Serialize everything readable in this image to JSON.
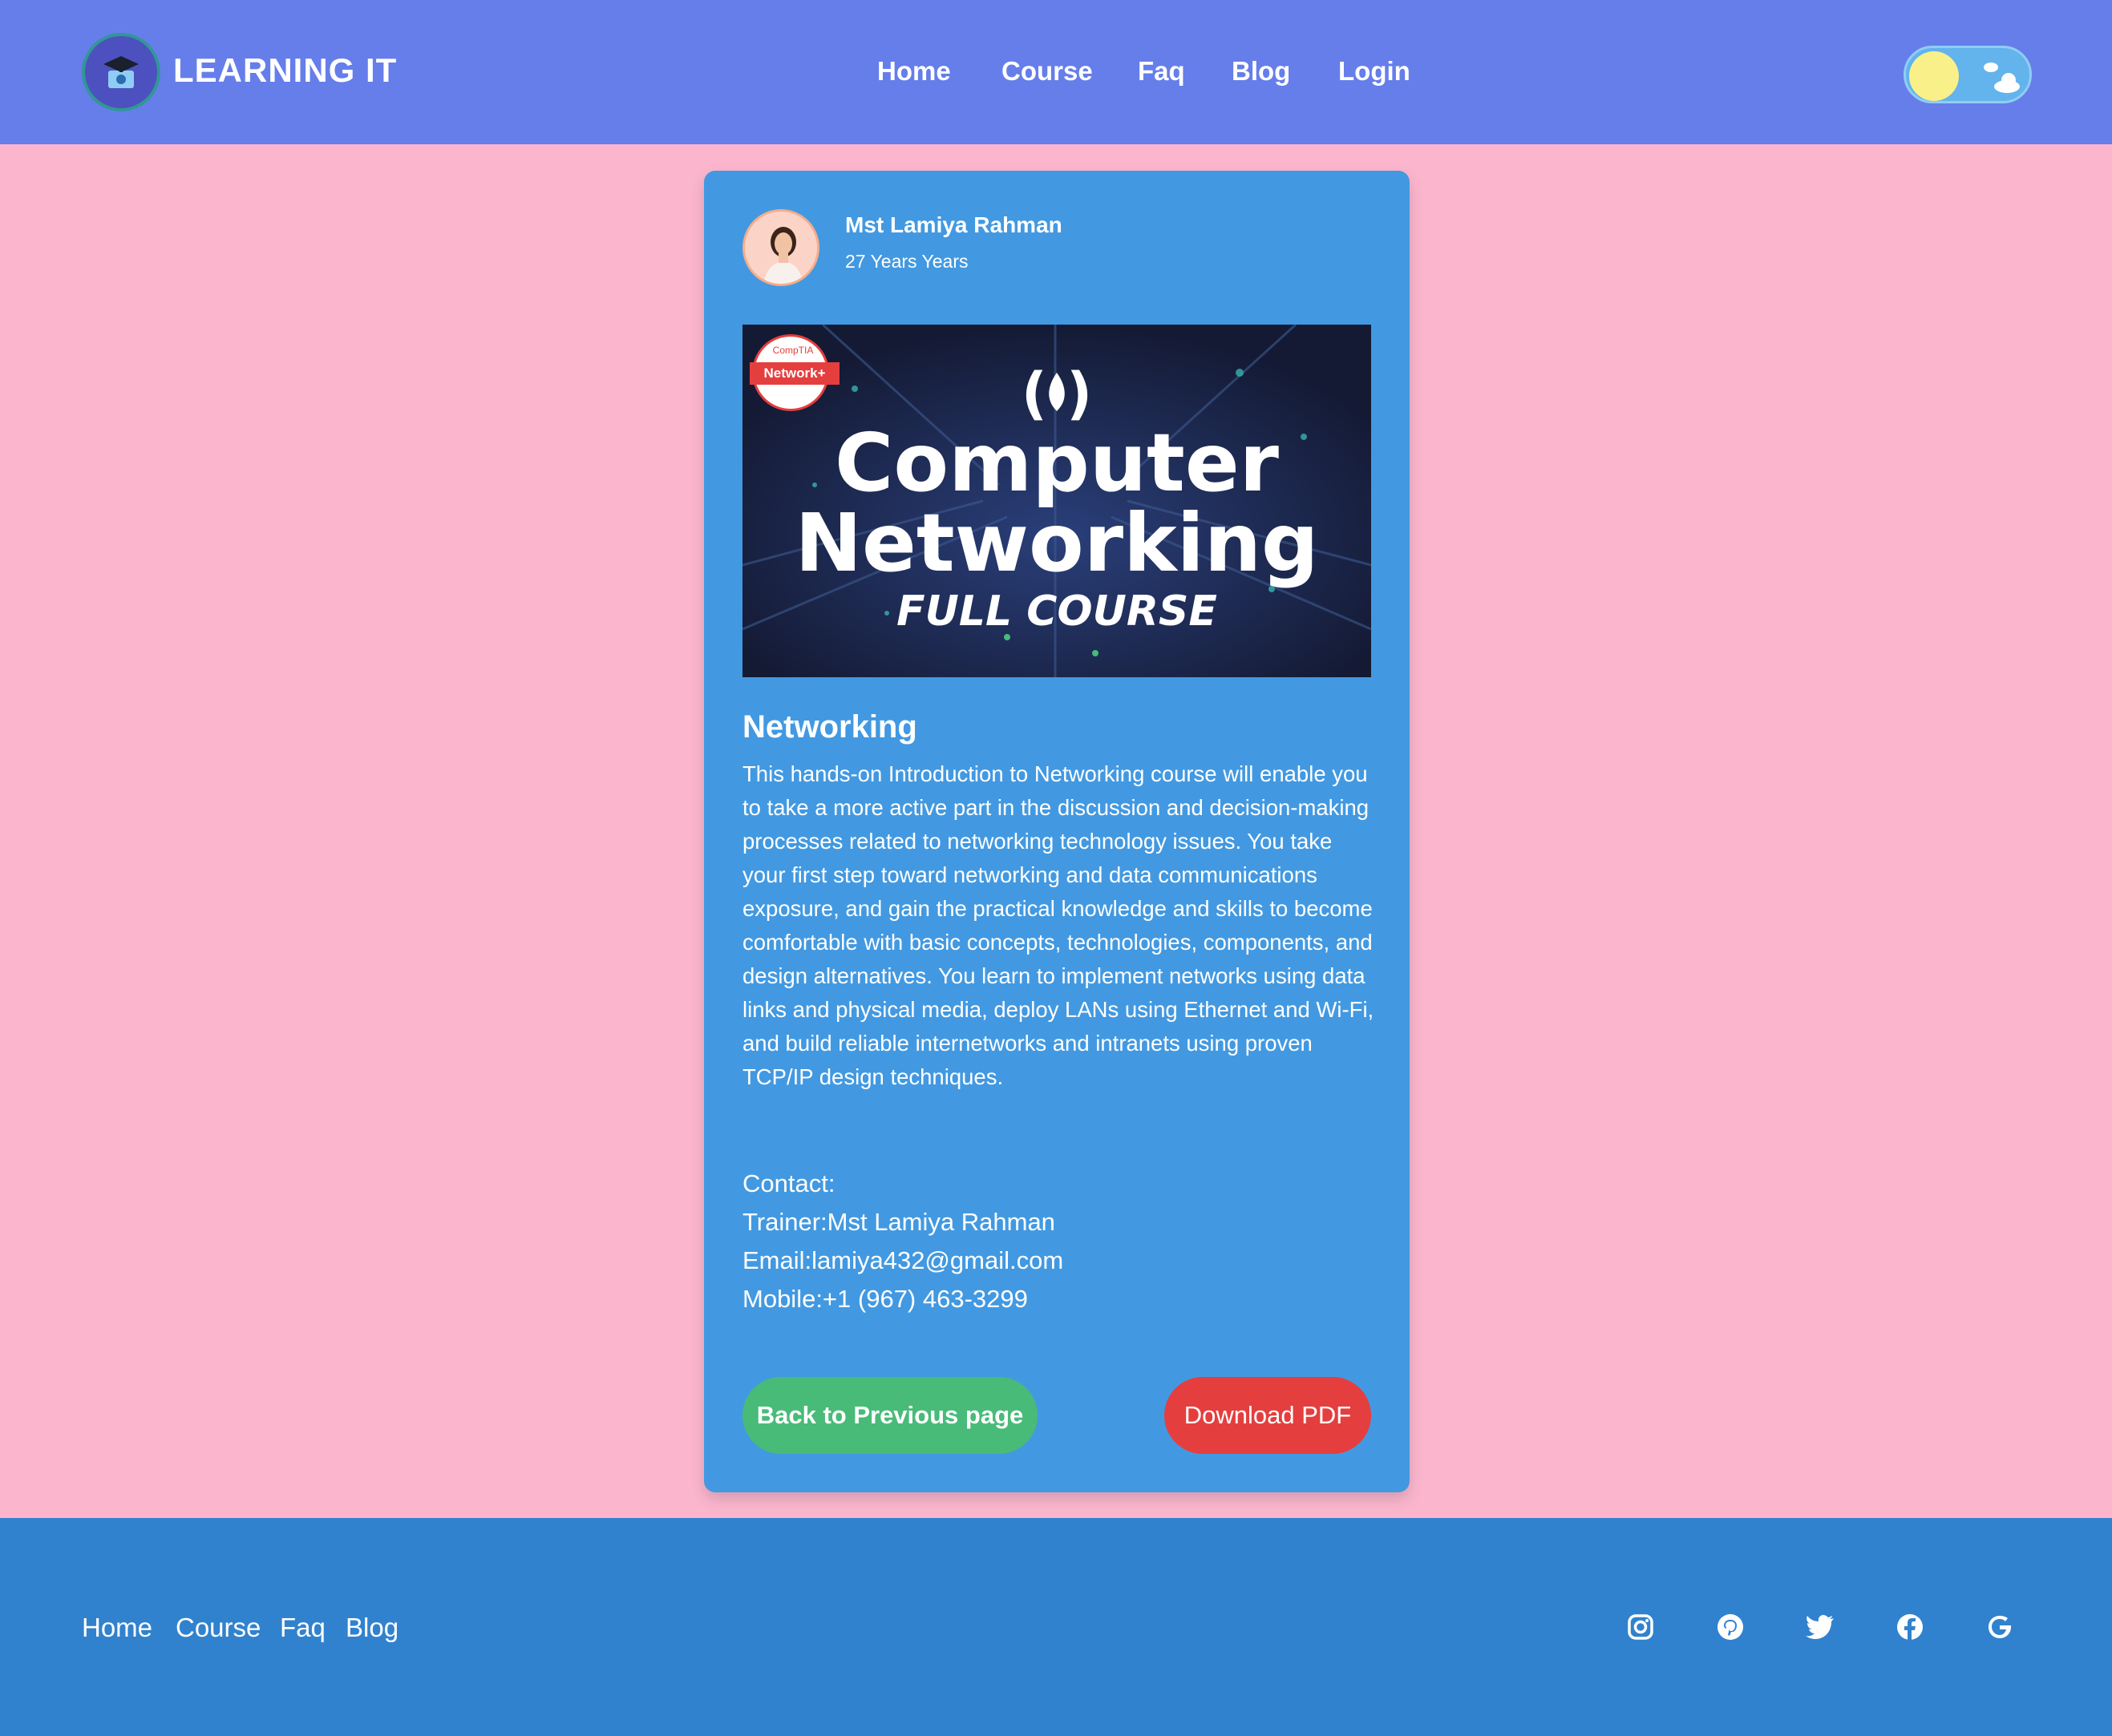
{
  "header": {
    "brand": "LEARNING IT",
    "nav": [
      "Home",
      "Course",
      "Faq",
      "Blog",
      "Login"
    ]
  },
  "card": {
    "trainer_name": "Mst Lamiya Rahman",
    "trainer_experience": "27 Years Years",
    "image": {
      "badge_top": "CompTIA",
      "badge_label": "Network+",
      "line1": "Computer",
      "line2": "Networking",
      "line3": "FULL COURSE"
    },
    "title": "Networking",
    "description": "This hands-on Introduction to Networking course will enable you to take a more active part in the discussion and decision-making processes related to networking technology issues. You take your first step toward networking and data communications exposure, and gain the practical knowledge and skills to become comfortable with basic concepts, technologies, components, and design alternatives. You learn to implement networks using data links and physical media, deploy LANs using Ethernet and Wi-Fi, and build reliable internetworks and intranets using proven TCP/IP design techniques.",
    "contact": {
      "heading": "Contact:",
      "trainer": "Trainer:Mst Lamiya Rahman",
      "email": "Email:lamiya432@gmail.com",
      "mobile": "Mobile:+1 (967) 463-3299"
    },
    "back_label": "Back to Previous page",
    "pdf_label": "Download PDF"
  },
  "footer": {
    "links": [
      "Home",
      "Course",
      "Faq",
      "Blog"
    ],
    "social": [
      "instagram-icon",
      "pinterest-icon",
      "twitter-icon",
      "facebook-icon",
      "google-icon"
    ]
  },
  "colors": {
    "header": "#667eea",
    "page": "#fbb6ce",
    "card": "#4299e1",
    "footer": "#3182ce",
    "back_button": "#48bb78",
    "pdf_button": "#e53e3e"
  }
}
